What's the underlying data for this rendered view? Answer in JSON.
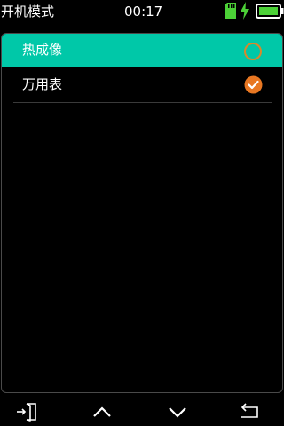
{
  "status_bar": {
    "title": "开机模式",
    "time": "00:17",
    "icons": [
      "sd-card-icon",
      "charging-bolt-icon",
      "battery-icon"
    ],
    "colors": {
      "icon_green": "#4cd137"
    }
  },
  "menu": {
    "items": [
      {
        "label": "热成像",
        "selected": false,
        "highlighted": true
      },
      {
        "label": "万用表",
        "selected": true,
        "highlighted": false
      }
    ],
    "colors": {
      "highlight": "#00c8a8",
      "check": "#e87722"
    }
  },
  "bottom_nav": {
    "icons": [
      "exit-icon",
      "chevron-up-icon",
      "chevron-down-icon",
      "return-icon"
    ]
  }
}
